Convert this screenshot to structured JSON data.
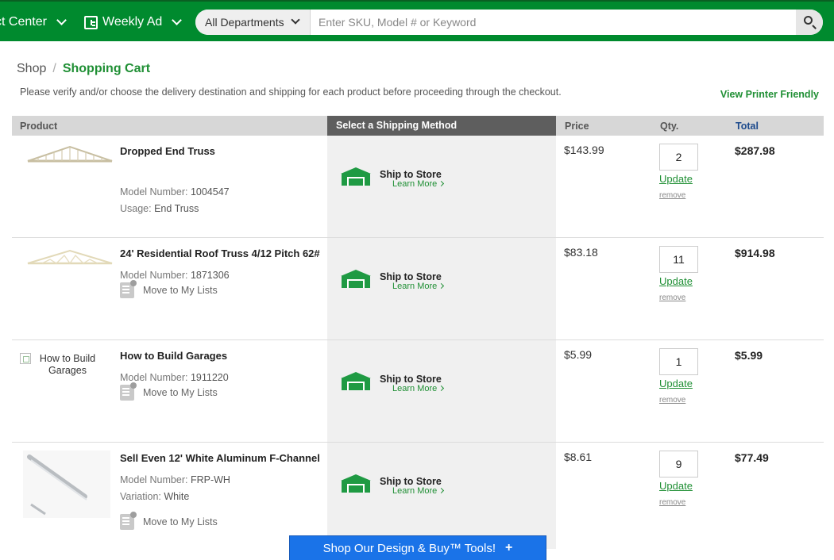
{
  "topbar": {
    "projects_label": "ct Center",
    "weekly_ad_label": "Weekly Ad",
    "department_select": "All Departments",
    "search_placeholder": "Enter SKU, Model # or Keyword"
  },
  "breadcrumb": {
    "root": "Shop",
    "separator": "/",
    "current": "Shopping Cart"
  },
  "notice": "Please verify and/or choose the delivery destination and shipping for each product before proceeding through the checkout.",
  "printer_friendly": "View Printer Friendly",
  "table": {
    "headers": {
      "product": "Product",
      "shipping": "Select a Shipping Method",
      "price": "Price",
      "qty": "Qty.",
      "total": "Total"
    },
    "common": {
      "model_label": "Model Number:",
      "move_to_lists": "Move to My Lists",
      "ship_to_store": "Ship to Store",
      "learn_more": "Learn More",
      "update": "Update",
      "remove": "remove"
    },
    "rows": [
      {
        "name": "Dropped End Truss",
        "model": "1004547",
        "extra_label": "Usage:",
        "extra_value": "End Truss",
        "price": "$143.99",
        "qty": "2",
        "total": "$287.98"
      },
      {
        "name": "24' Residential Roof Truss 4/12 Pitch 62#",
        "model": "1871306",
        "price": "$83.18",
        "qty": "11",
        "total": "$914.98"
      },
      {
        "name": "How to Build Garages",
        "image_alt": "How to Build Garages",
        "model": "1911220",
        "price": "$5.99",
        "qty": "1",
        "total": "$5.99"
      },
      {
        "name": "Sell Even 12' White Aluminum F-Channel",
        "model": "FRP-WH",
        "extra_label": "Variation:",
        "extra_value": "White",
        "price": "$8.61",
        "qty": "9",
        "total": "$77.49"
      }
    ]
  },
  "cta": {
    "label": "Shop Our Design & Buy™ Tools!",
    "plus": "+"
  },
  "colors": {
    "brand_green": "#008a2e",
    "link_green": "#1f8f34",
    "cta_blue": "#1a73e8"
  }
}
